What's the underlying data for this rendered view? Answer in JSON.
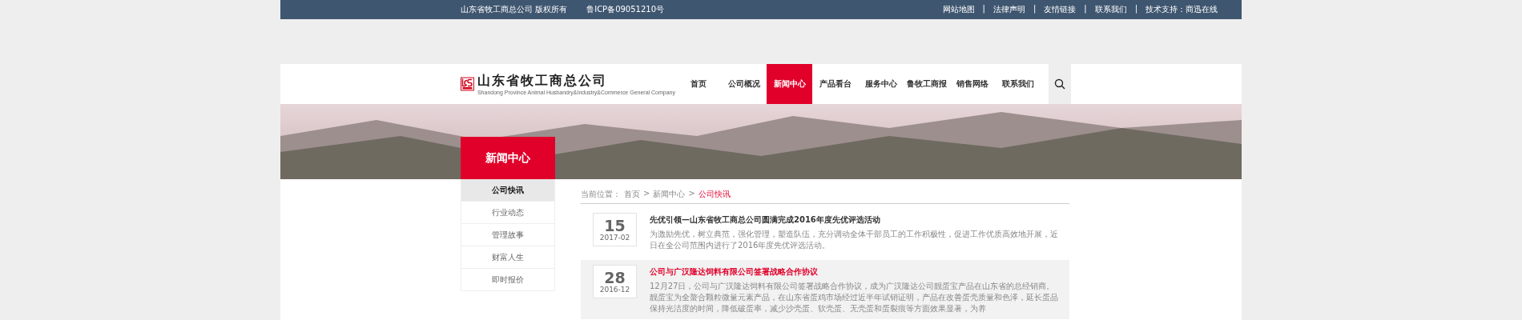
{
  "top_bar": {
    "copyright": "山东省牧工商总公司 版权所有",
    "icp": "鲁ICP备09051210号",
    "separator": "|",
    "links": [
      "网站地图",
      "法律声明",
      "友情链接",
      "联系我们",
      "技术支持：商迅在线"
    ]
  },
  "header": {
    "logo_name": "山东省牧工商总公司",
    "logo_subtitle": "Shandong Province Animal Husbandry&Industry&Commerce General Company",
    "nav": [
      {
        "label": "首页",
        "selected": false
      },
      {
        "label": "公司概况",
        "selected": false
      },
      {
        "label": "新闻中心",
        "selected": true
      },
      {
        "label": "产品看台",
        "selected": false
      },
      {
        "label": "服务中心",
        "selected": false
      },
      {
        "label": "鲁牧工商报",
        "selected": false
      },
      {
        "label": "销售网络",
        "selected": false
      },
      {
        "label": "联系我们",
        "selected": false
      }
    ]
  },
  "sidebar": {
    "title": "新闻中心",
    "items": [
      {
        "label": "公司快讯",
        "selected": true
      },
      {
        "label": "行业动态",
        "selected": false
      },
      {
        "label": "管理故事",
        "selected": false
      },
      {
        "label": "财富人生",
        "selected": false
      },
      {
        "label": "即时报价",
        "selected": false
      }
    ]
  },
  "breadcrumb": {
    "prefix": "当前位置：",
    "separator": ">",
    "items": [
      {
        "label": "首页",
        "current": false
      },
      {
        "label": "新闻中心",
        "current": false
      },
      {
        "label": "公司快讯",
        "current": true
      }
    ]
  },
  "news": [
    {
      "day": "15",
      "month": "2017-02",
      "title": "先优引领—山东省牧工商总公司圆满完成2016年度先优评选活动",
      "highlighted": false,
      "summary": "为激励先优，树立典范，强化管理，塑造队伍，充分调动全体干部员工的工作积极性，促进工作优质高效地开展，近日在全公司范围内进行了2016年度先优评选活动。"
    },
    {
      "day": "28",
      "month": "2016-12",
      "title": "公司与广汉隆达饲料有限公司签署战略合作协议",
      "highlighted": true,
      "summary": "12月27日，公司与广汉隆达饲料有限公司签署战略合作协议，成为广汉隆达公司靓蛋宝产品在山东省的总经销商。靓蛋宝为全螯合颗粒微量元素产品，在山东省蛋鸡市场经过近半年试销证明，产品在改善蛋壳质量和色泽，延长蛋品保持光洁度的时间，降低破蛋率，减少沙壳蛋、软壳蛋、无壳蛋和蛋裂痕等方面效果显著，为养"
    }
  ]
}
